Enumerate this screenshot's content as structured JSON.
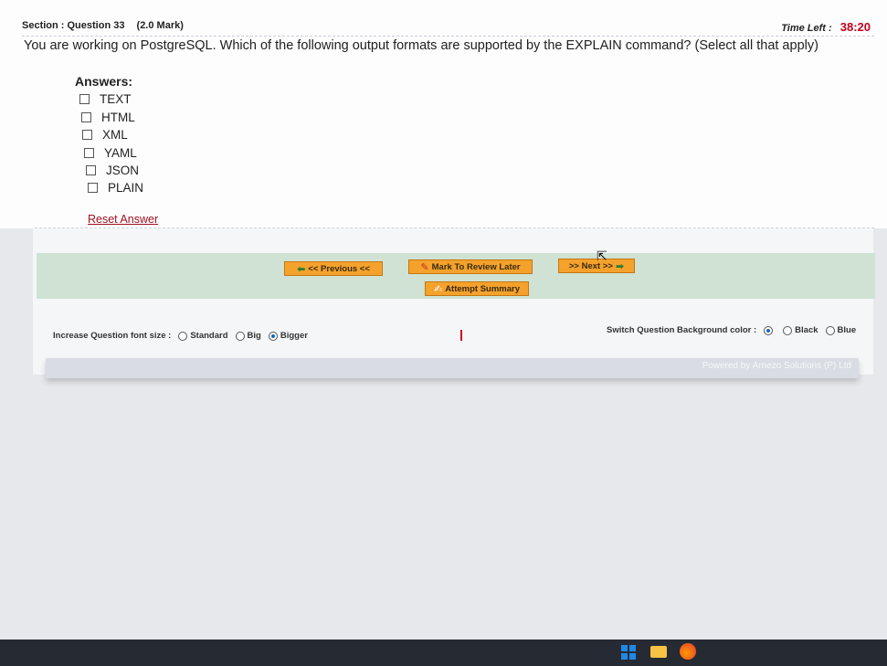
{
  "header": {
    "section_label": "Section : Question 33",
    "marks_label": "(2.0 Mark)",
    "time_left_label": "Time Left :",
    "time_left_value": "38:20"
  },
  "question": {
    "text": "You are working on PostgreSQL. Which of the following output formats are supported by the EXPLAIN command? (Select all that apply)"
  },
  "answers": {
    "title": "Answers:",
    "options": [
      "TEXT",
      "HTML",
      "XML",
      "YAML",
      "JSON",
      "PLAIN"
    ]
  },
  "reset_label": "Reset Answer",
  "navigation": {
    "previous_label": "<< Previous <<",
    "mark_review_label": "Mark To Review Later",
    "next_label": ">> Next >>",
    "attempt_summary_label": "Attempt Summary"
  },
  "font_size": {
    "label": "Increase Question font size :",
    "options": [
      "Standard",
      "Big",
      "Bigger"
    ],
    "selected": "Bigger"
  },
  "background": {
    "label": "Switch Question Background color :",
    "options": [
      "Black",
      "Blue"
    ]
  },
  "footer": {
    "powered_by": "Powered by  Arnezo Solutions (P) Ltd"
  },
  "colors": {
    "accent_orange": "#f4a22c",
    "nav_band": "#cfe2d4",
    "timer_red": "#c3001b"
  }
}
